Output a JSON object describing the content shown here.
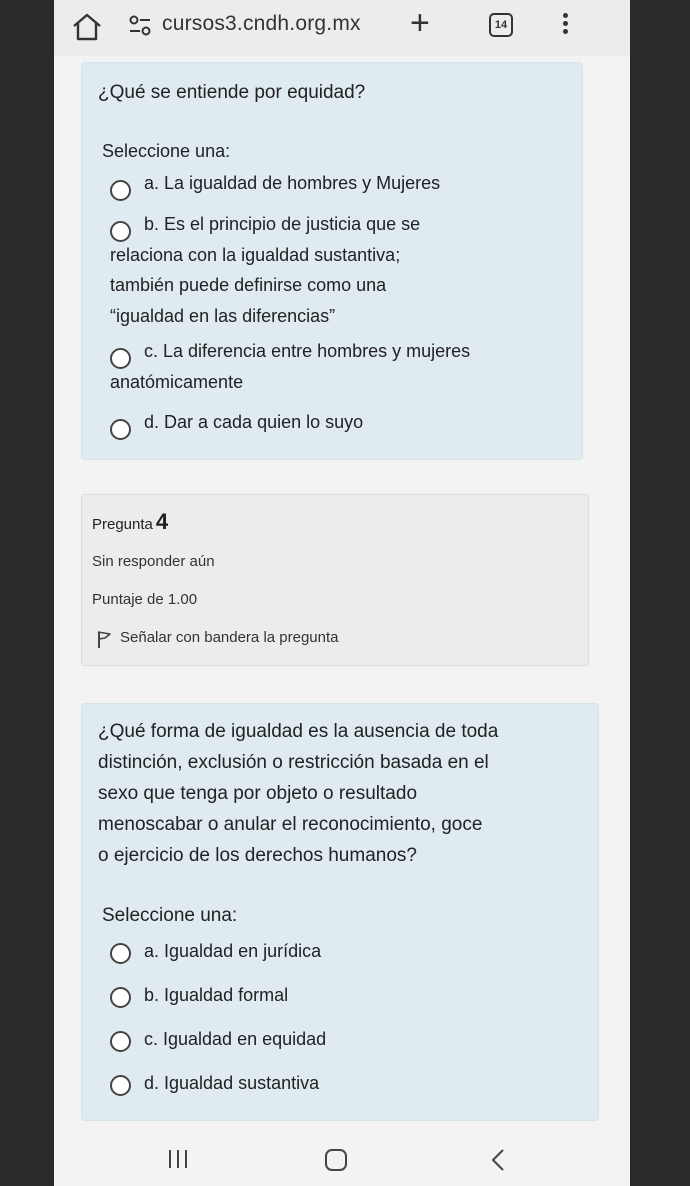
{
  "browser": {
    "url": "cursos3.cndh.org.mx",
    "tab_count": "14"
  },
  "question3": {
    "text": "¿Qué se entiende por equidad?",
    "select_label": "Seleccione una:",
    "options": [
      {
        "lines": [
          "a. La igualdad de hombres y Mujeres"
        ]
      },
      {
        "lines": [
          "b. Es el principio de justicia que se",
          "relaciona con la igualdad sustantiva;",
          "también puede definirse como una",
          "“igualdad en las diferencias”"
        ]
      },
      {
        "lines": [
          "c. La diferencia entre hombres y mujeres",
          "anatómicamente"
        ]
      },
      {
        "lines": [
          "d. Dar a cada quien lo suyo"
        ]
      }
    ]
  },
  "question4_info": {
    "label": "Pregunta",
    "number": "4",
    "status": "Sin responder aún",
    "score": "Puntaje de 1.00",
    "flag_label": "Señalar con bandera la pregunta"
  },
  "question4": {
    "lines": [
      "¿Qué forma de igualdad es la ausencia de toda",
      "distinción, exclusión o restricción basada en el",
      "sexo que tenga por objeto o resultado",
      "menoscabar o anular el reconocimiento, goce",
      "o ejercicio de los derechos humanos?"
    ],
    "select_label": "Seleccione una:",
    "options": [
      "a. Igualdad en jurídica",
      "b. Igualdad formal",
      "c. Igualdad en equidad",
      "d. Igualdad sustantiva"
    ]
  },
  "colors": {
    "card_bg": "#dfeaf1",
    "info_bg": "#ececec"
  }
}
